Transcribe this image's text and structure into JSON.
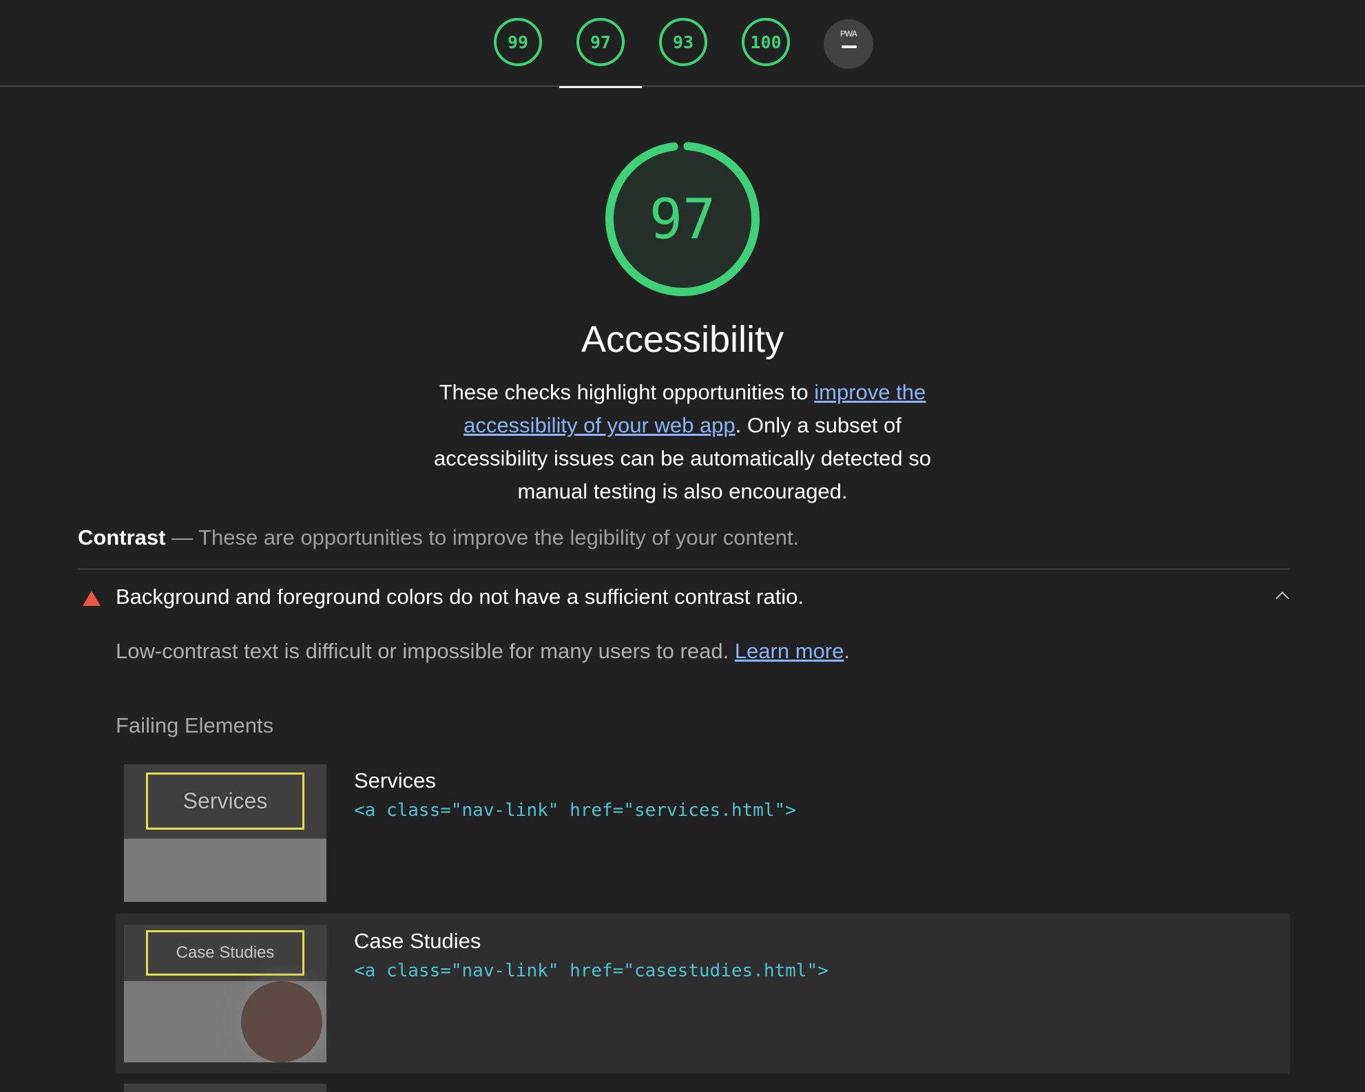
{
  "scores": [
    {
      "label": "99",
      "color": "#3ed178"
    },
    {
      "label": "97",
      "color": "#3ed178"
    },
    {
      "label": "93",
      "color": "#3ed178"
    },
    {
      "label": "100",
      "color": "#3ed178"
    }
  ],
  "pwa": {
    "text": "PWA"
  },
  "category": {
    "score": "97",
    "score_fraction": 0.97,
    "title": "Accessibility",
    "desc_before": "These checks highlight opportunities to ",
    "desc_link": "improve the accessibility of your web app",
    "desc_after": ". Only a subset of accessibility issues can be automatically detected so manual testing is also encouraged."
  },
  "group": {
    "title": "Contrast",
    "separator": " — ",
    "description": "These are opportunities to improve the legibility of your content."
  },
  "audit": {
    "title": "Background and foreground colors do not have a sufficient contrast ratio.",
    "desc_text": "Low-contrast text is difficult or impossible for many users to read. ",
    "learn_more": "Learn more",
    "desc_end": ".",
    "failing_label": "Failing Elements"
  },
  "elements": [
    {
      "label": "Services",
      "snippet": "<a class=\"nav-link\" href=\"services.html\">",
      "thumb_text": "Services"
    },
    {
      "label": "Case Studies",
      "snippet": "<a class=\"nav-link\" href=\"casestudies.html\">",
      "thumb_text": "Case Studies"
    }
  ],
  "colors": {
    "pass": "#3ed178",
    "fail": "#eb5744",
    "link": "#8ab4f8",
    "code": "#4fc3d4"
  }
}
